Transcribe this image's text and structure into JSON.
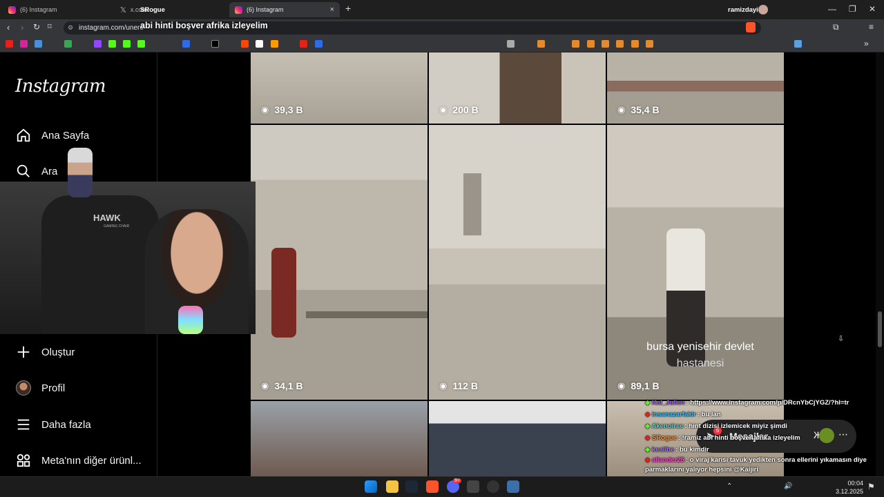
{
  "tabs": [
    {
      "label": "(6) Instagram"
    },
    {
      "label": "x.com/"
    },
    {
      "label": "(6) Instagram",
      "close": "×"
    }
  ],
  "new_tab": "+",
  "profile_name": "ramizdayi",
  "window_controls": {
    "minimize": "—",
    "restore": "❐",
    "close": "✕"
  },
  "streamer_overlay_name": "SRogue",
  "stream_title": "abi hinti boşver afrika izleyelim",
  "address": {
    "url": "instagram.com/unere"
  },
  "sidebar": {
    "logo": "Instagram",
    "items": [
      {
        "label": "Ana Sayfa",
        "icon": "home-icon"
      },
      {
        "label": "Ara",
        "icon": "search-icon"
      },
      {
        "label": "Oluştur",
        "icon": "plus-icon"
      },
      {
        "label": "Profil",
        "icon": "avatar-icon"
      },
      {
        "label": "Daha fazla",
        "icon": "menu-icon"
      },
      {
        "label": "Meta'nın diğer ürünl...",
        "icon": "apps-icon"
      }
    ]
  },
  "grid": {
    "tiles": [
      {
        "views": "39,3 B"
      },
      {
        "views": "200 B"
      },
      {
        "views": "35,4 B"
      },
      {
        "views": "34,1 B"
      },
      {
        "views": "112 B"
      },
      {
        "views": "89,1 B",
        "caption_line1": "bursa yenisehir devlet",
        "caption_line2": "hastanesi"
      },
      {
        "views": ""
      },
      {
        "views": ""
      },
      {
        "views": ""
      }
    ]
  },
  "webcam": {
    "chair_brand": "HAWK",
    "chair_sub": "GAMING CHAIR"
  },
  "messages": {
    "label": "Mesajlar"
  },
  "chat": [
    {
      "user": "Kal_Julien",
      "text": ": https://www.instagram.com/p/DRcnYbCjYGZ/?hl=tr",
      "color": "#9c5cff"
    },
    {
      "user": "insanazarfakir",
      "text": ": bu lan",
      "color": "#3ec1ff"
    },
    {
      "user": "Akenoirse",
      "text": ": hint dizisi izlemicek miyiz şimdi",
      "color": "#4fe0d0"
    },
    {
      "user": "SRogue",
      "text": ": !ramiz abi hinti boşver afrika izleyelim",
      "color": "#ff9a3c"
    },
    {
      "user": "kealibe",
      "text": ": bu kimdir",
      "color": "#a970ff"
    },
    {
      "user": "aliander25",
      "text": ": o viraj karısı tavuk yedikten sonra ellerini yıkamasın diye parmaklarını yalıyor hepsini @Kaijiri",
      "color": "#ff4dd2"
    }
  ],
  "clock": {
    "time": "00:04",
    "date": "3.12.2025"
  },
  "taskbar": {
    "discord_badge": "9+"
  }
}
